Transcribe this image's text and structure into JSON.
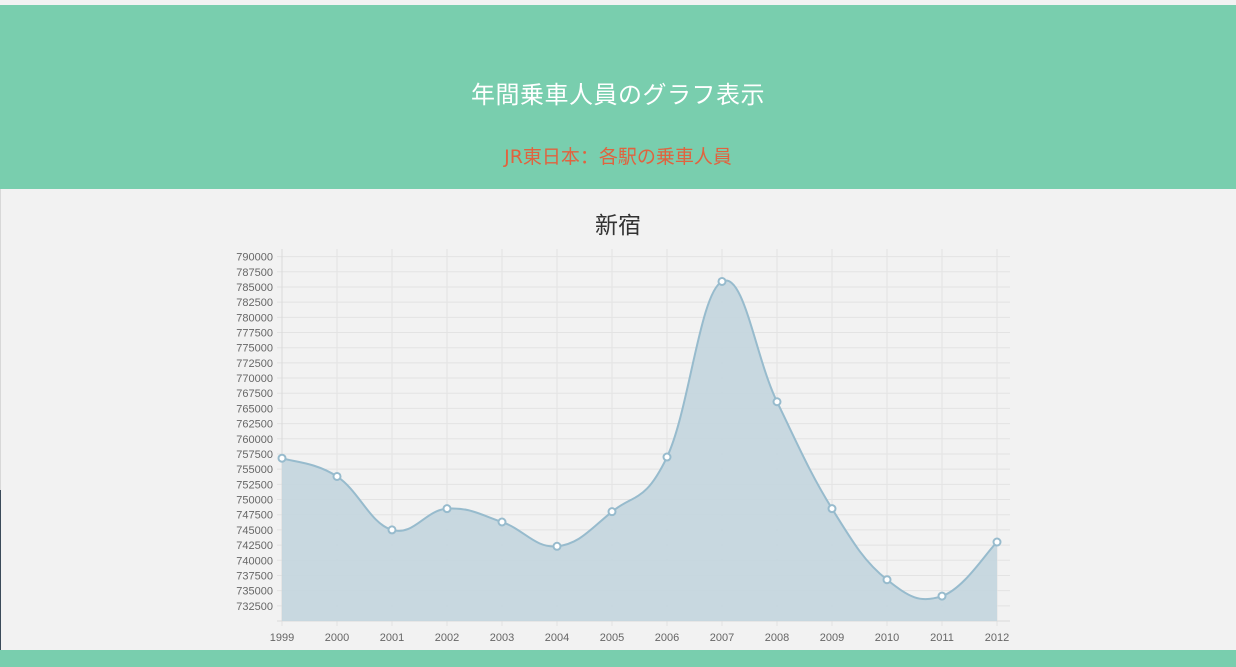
{
  "header": {
    "title": "年間乗車人員のグラフ表示",
    "subtitle": "JR東日本：各駅の乗車人員"
  },
  "colors": {
    "header_bg": "#79ceae",
    "subtitle": "#e0633f",
    "series_line": "#97bbcd",
    "series_fill": "#c5d6de"
  },
  "chart_data": {
    "type": "area",
    "title": "新宿",
    "xlabel": "",
    "ylabel": "",
    "categories": [
      "1999",
      "2000",
      "2001",
      "2002",
      "2003",
      "2004",
      "2005",
      "2006",
      "2007",
      "2008",
      "2009",
      "2010",
      "2011",
      "2012"
    ],
    "series": [
      {
        "values": [
          756800,
          753800,
          745000,
          748500,
          746300,
          742300,
          748000,
          757000,
          785900,
          766100,
          748500,
          736800,
          734100,
          743000
        ]
      }
    ],
    "ylim": [
      730000,
      791250
    ],
    "yticks": [
      732500,
      735000,
      737500,
      740000,
      742500,
      745000,
      747500,
      750000,
      752500,
      755000,
      757500,
      760000,
      762500,
      765000,
      767500,
      770000,
      772500,
      775000,
      777500,
      780000,
      782500,
      785000,
      787500,
      790000
    ],
    "grid": true,
    "legend": "none"
  }
}
